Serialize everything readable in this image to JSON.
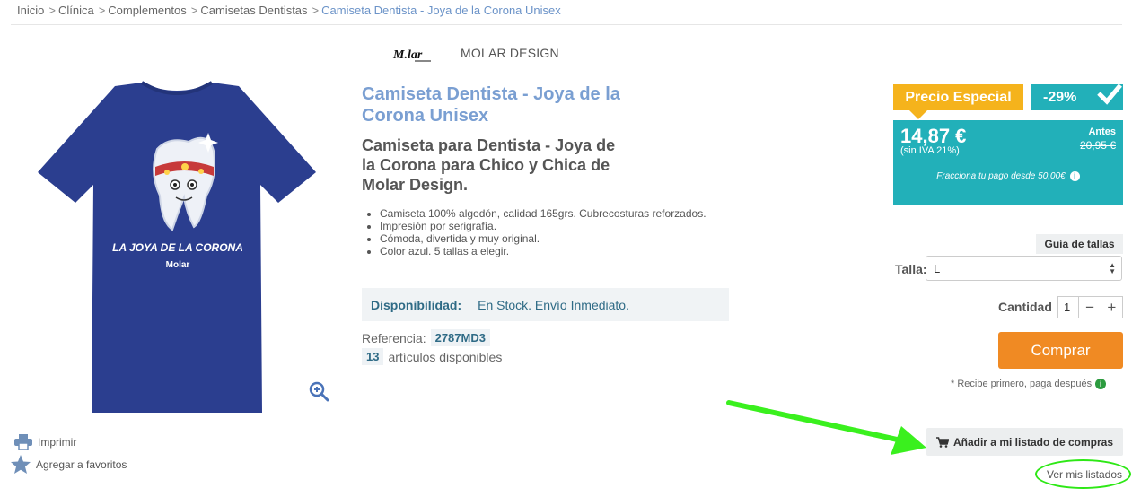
{
  "breadcrumb": [
    {
      "label": "Inicio"
    },
    {
      "label": "Clínica"
    },
    {
      "label": "Complementos"
    },
    {
      "label": "Camisetas Dentistas"
    },
    {
      "label": "Camiseta Dentista - Joya de la Corona Unisex"
    }
  ],
  "product": {
    "image": {
      "print_line": "LA JOYA DE LA CORONA",
      "print_logo": "Molar",
      "shirt_color": "#2b3e8f"
    },
    "brand": {
      "logo_text": "M.lar",
      "name": "MOLAR DESIGN"
    },
    "title": "Camiseta Dentista - Joya de la Corona Unisex",
    "subtitle": "Camiseta para Dentista - Joya de la Corona para Chico y Chica de Molar Design.",
    "features": [
      "Camiseta 100% algodón, calidad 165grs. Cubrecosturas reforzados.",
      "Impresión por serigrafía.",
      "Cómoda, divertida y muy original.",
      "Color azul. 5 tallas a elegir."
    ],
    "availability": {
      "label": "Disponibilidad:",
      "value": "En Stock. Envío Inmediato."
    },
    "reference": {
      "label": "Referencia:",
      "code": "2787MD3"
    },
    "stock": {
      "count": "13",
      "label": "artículos disponibles"
    }
  },
  "side_links": {
    "print": "Imprimir",
    "favorites": "Agregar a favoritos"
  },
  "pricing": {
    "special_label": "Precio Especial",
    "discount": "-29%",
    "price": "14,87 €",
    "tax_note": "(sin IVA 21%)",
    "before_label": "Antes",
    "before_price": "20,95 €",
    "finance_note": "Fracciona tu pago desde 50,00€",
    "info_glyph": "i",
    "accent_teal": "#22b0b9",
    "accent_yellow": "#f5b31c"
  },
  "purchase": {
    "size_guide": "Guía de tallas",
    "size_label": "Talla:",
    "size_value": "L",
    "quantity_label": "Cantidad",
    "quantity_value": "1",
    "minus": "−",
    "plus": "+",
    "buy_label": "Comprar",
    "buy_color": "#f08a23",
    "pay_later": "* Recibe primero, paga después",
    "add_to_list": "Añadir a mi listado de compras",
    "view_lists": "Ver mis listados"
  }
}
